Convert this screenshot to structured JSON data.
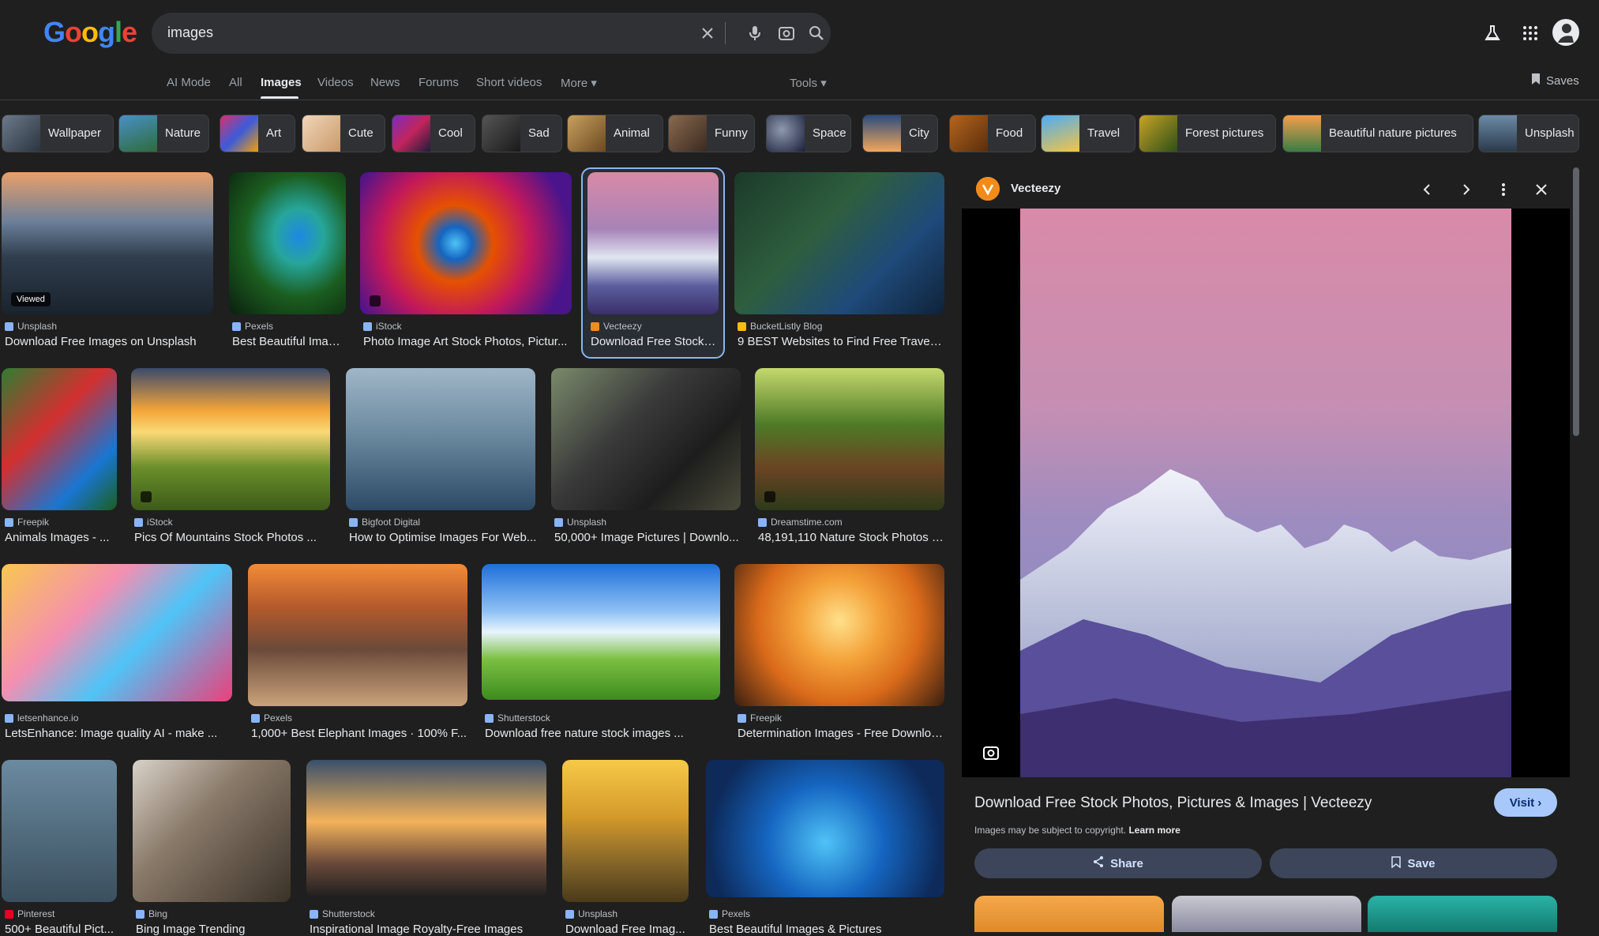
{
  "search": {
    "query": "images"
  },
  "tabs": [
    {
      "label": "AI Mode"
    },
    {
      "label": "All"
    },
    {
      "label": "Images"
    },
    {
      "label": "Videos"
    },
    {
      "label": "News"
    },
    {
      "label": "Forums"
    },
    {
      "label": "Short videos"
    },
    {
      "label": "More"
    },
    {
      "label": "Tools"
    }
  ],
  "saves_label": "Saves",
  "chips": [
    {
      "label": "Wallpaper"
    },
    {
      "label": "Nature"
    },
    {
      "label": "Art"
    },
    {
      "label": "Cute"
    },
    {
      "label": "Cool"
    },
    {
      "label": "Sad"
    },
    {
      "label": "Animal"
    },
    {
      "label": "Funny"
    },
    {
      "label": "Space"
    },
    {
      "label": "City"
    },
    {
      "label": "Food"
    },
    {
      "label": "Travel"
    },
    {
      "label": "Forest pictures"
    },
    {
      "label": "Beautiful nature pictures"
    },
    {
      "label": "Unsplash"
    }
  ],
  "results": [
    {
      "source": "Unsplash",
      "title": "Download Free Images on Unsplash",
      "badge": "Viewed"
    },
    {
      "source": "Pexels",
      "title": "Best Beautiful Imag..."
    },
    {
      "source": "iStock",
      "title": "Photo Image Art Stock Photos, Pictur..."
    },
    {
      "source": "Vecteezy",
      "title": "Download Free Stock ..."
    },
    {
      "source": "BucketListly Blog",
      "title": "9 BEST Websites to Find Free Travel ..."
    },
    {
      "source": "Freepik",
      "title": "Animals Images - ..."
    },
    {
      "source": "iStock",
      "title": "Pics Of Mountains Stock Photos ..."
    },
    {
      "source": "Bigfoot Digital",
      "title": "How to Optimise Images For Web..."
    },
    {
      "source": "Unsplash",
      "title": "50,000+ Image Pictures | Downlo..."
    },
    {
      "source": "Dreamstime.com",
      "title": "48,191,110 Nature Stock Photos -..."
    },
    {
      "source": "letsenhance.io",
      "title": "LetsEnhance: Image quality AI - make ..."
    },
    {
      "source": "Pexels",
      "title": "1,000+ Best Elephant Images · 100% F..."
    },
    {
      "source": "Shutterstock",
      "title": "Download free nature stock images ..."
    },
    {
      "source": "Freepik",
      "title": "Determination Images - Free Downloa..."
    },
    {
      "source": "Pinterest",
      "title": "500+ Beautiful Pict..."
    },
    {
      "source": "Bing",
      "title": "Bing Image Trending"
    },
    {
      "source": "Shutterstock",
      "title": "Inspirational Image Royalty-Free Images"
    },
    {
      "source": "Unsplash",
      "title": "Download Free Imag..."
    },
    {
      "source": "Pexels",
      "title": "Best Beautiful Images & Pictures"
    }
  ],
  "panel": {
    "source": "Vecteezy",
    "title": "Download Free Stock Photos, Pictures & Images | Vecteezy",
    "visit_label": "Visit",
    "copyright": "Images may be subject to copyright.",
    "learn_more": "Learn more",
    "share_label": "Share",
    "save_label": "Save"
  },
  "colors": {
    "background": "#1f1f1f",
    "accent": "#8ab4f8",
    "visit_button": "#a8c7fa"
  }
}
